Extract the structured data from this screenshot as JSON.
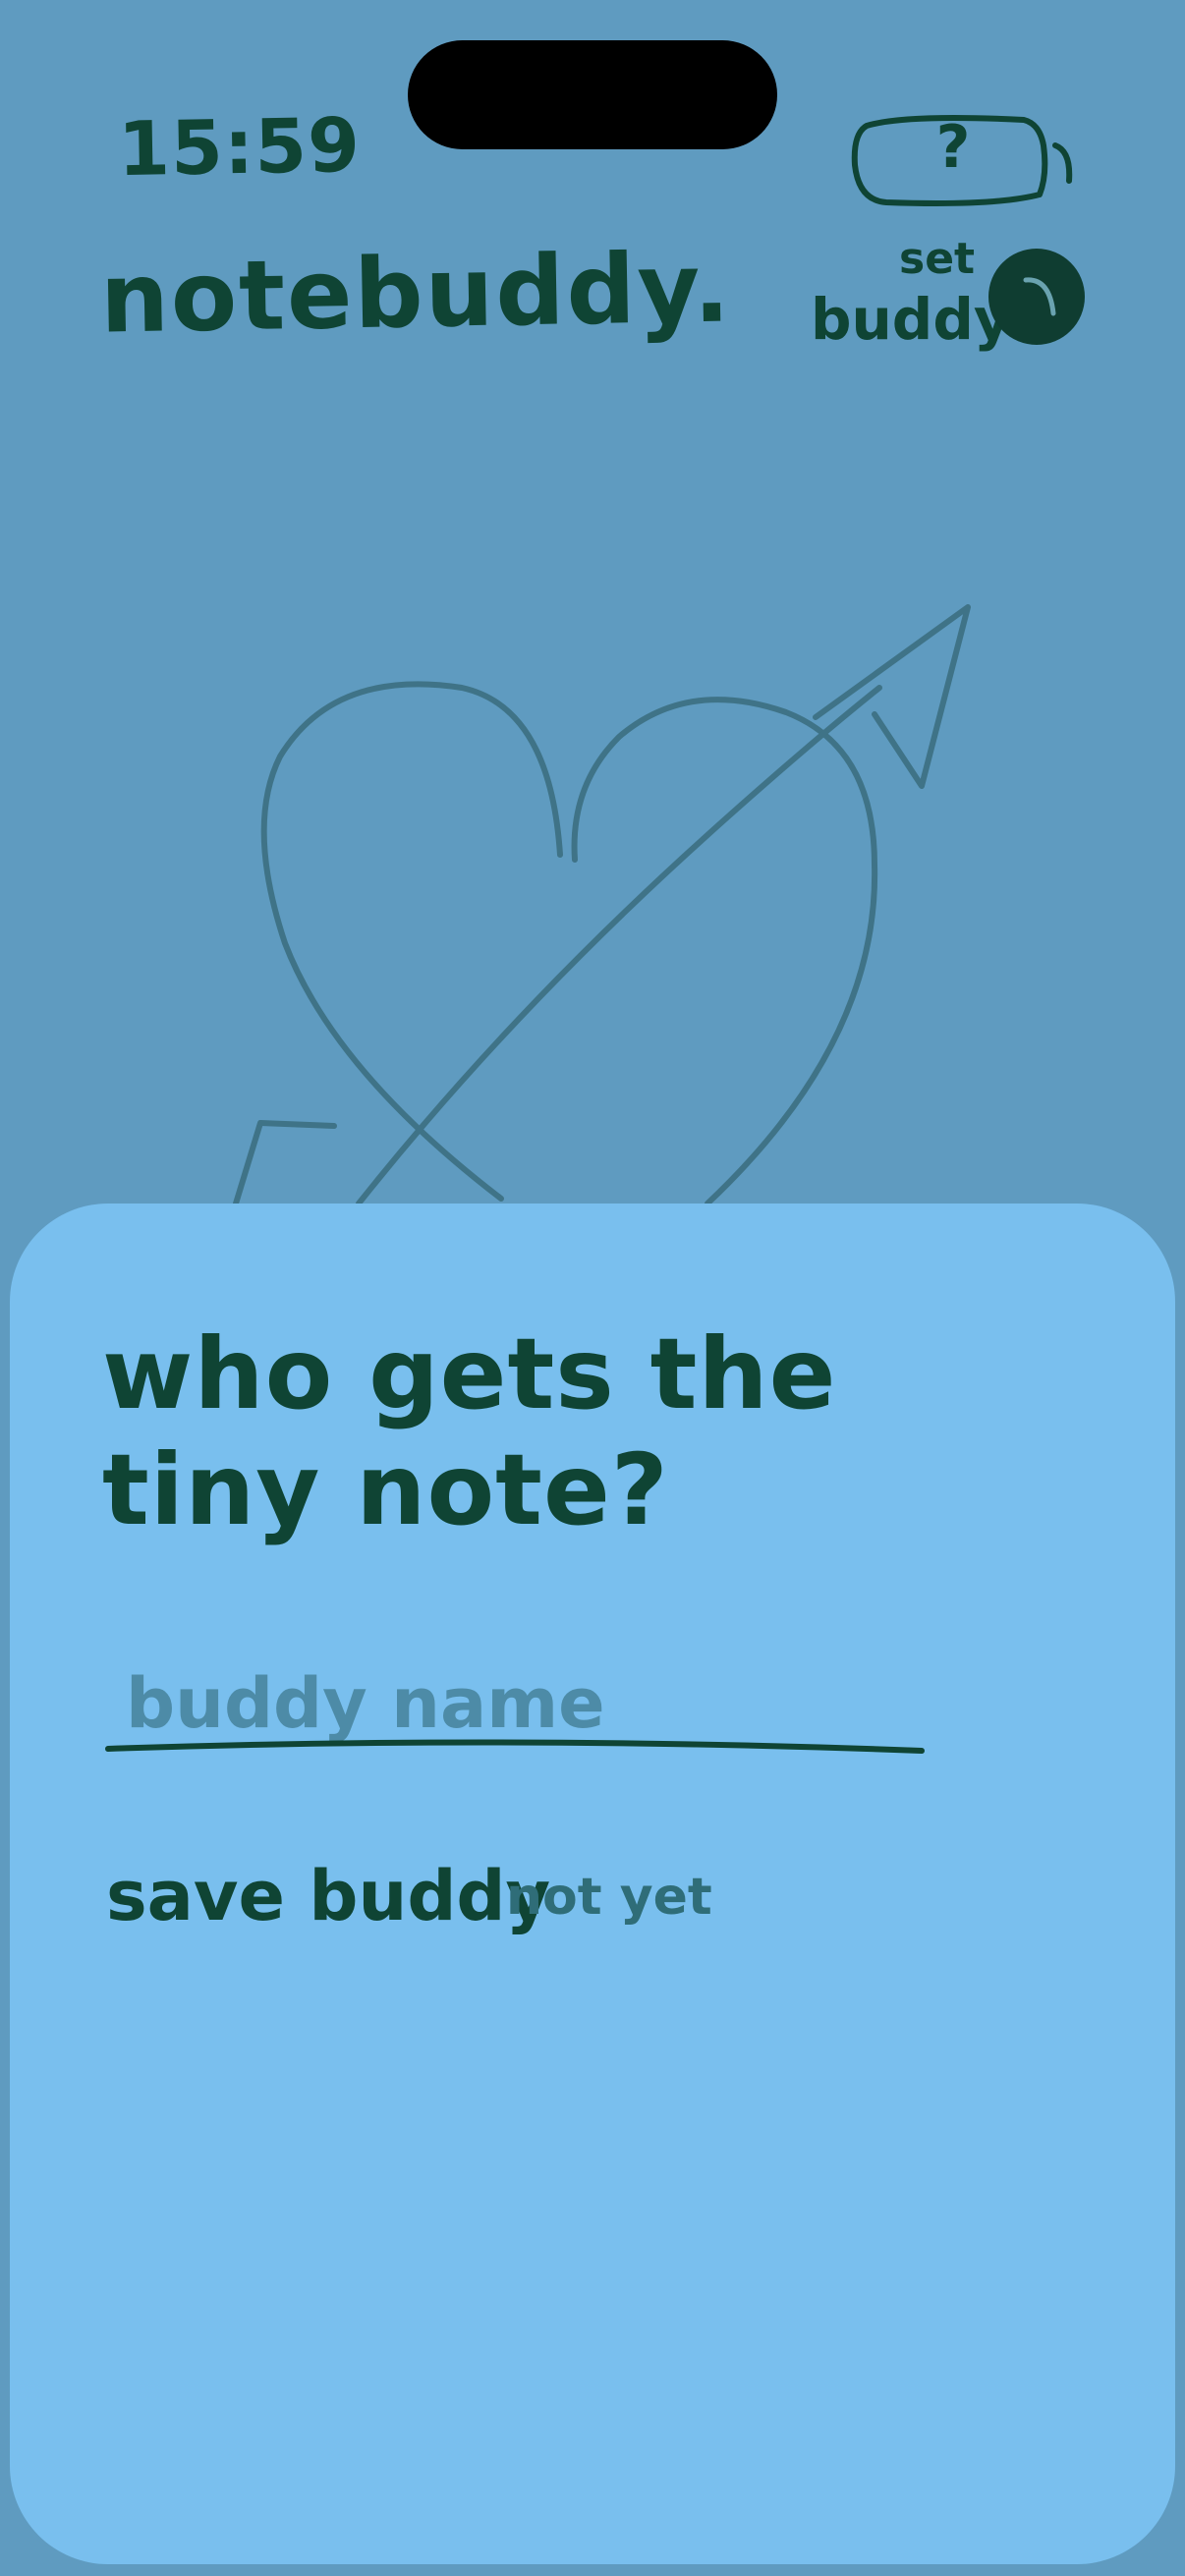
{
  "status_bar": {
    "time": "15:59",
    "battery_label": "?"
  },
  "header": {
    "brand": "notebuddy.",
    "set_label": "set",
    "buddy_label": "buddy",
    "avatar_icon": "buddy-avatar-icon"
  },
  "card": {
    "question": "who gets the tiny note?",
    "name_field": {
      "placeholder": "buddy name",
      "value": ""
    },
    "save_label": "save buddy",
    "status_text": "not yet"
  },
  "colors": {
    "background": "#5f9bc0",
    "card": "#79bfee",
    "ink": "#0f4434",
    "muted": "#2f6d78",
    "placeholder": "#4d8ba7",
    "doodle_stroke": "#3f7387"
  }
}
